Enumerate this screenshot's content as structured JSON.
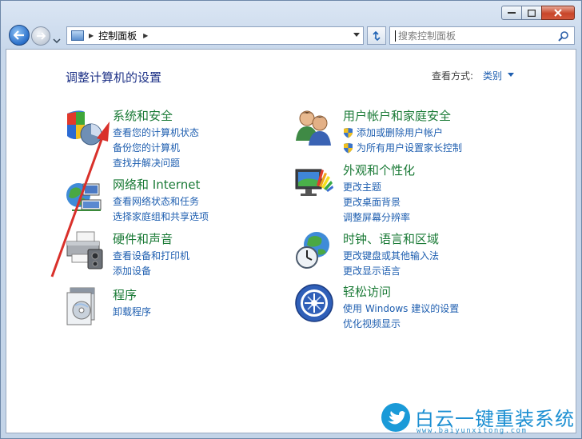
{
  "window": {
    "caption_buttons": [
      "minimize",
      "maximize",
      "close"
    ]
  },
  "navbar": {
    "breadcrumb": [
      "控制面板"
    ],
    "search_placeholder": "搜索控制面板"
  },
  "content": {
    "heading": "调整计算机的设置",
    "view_by_label": "查看方式:",
    "view_by_value": "类别"
  },
  "categories": {
    "system": {
      "title": "系统和安全",
      "icon": "shield-pie-icon",
      "links": [
        "查看您的计算机状态",
        "备份您的计算机",
        "查找并解决问题"
      ]
    },
    "network": {
      "title": "网络和 Internet",
      "icon": "globe-network-icon",
      "links": [
        "查看网络状态和任务",
        "选择家庭组和共享选项"
      ]
    },
    "hardware": {
      "title": "硬件和声音",
      "icon": "printer-icon",
      "links": [
        "查看设备和打印机",
        "添加设备"
      ]
    },
    "programs": {
      "title": "程序",
      "icon": "programs-disc-icon",
      "links": [
        "卸载程序"
      ]
    },
    "users": {
      "title": "用户帐户和家庭安全",
      "icon": "users-icon",
      "links": [
        "添加或删除用户帐户",
        "为所有用户设置家长控制"
      ]
    },
    "appearance": {
      "title": "外观和个性化",
      "icon": "monitor-palette-icon",
      "links": [
        "更改主题",
        "更改桌面背景",
        "调整屏幕分辨率"
      ]
    },
    "clock": {
      "title": "时钟、语言和区域",
      "icon": "globe-clock-icon",
      "links": [
        "更改键盘或其他输入法",
        "更改显示语言"
      ]
    },
    "ease": {
      "title": "轻松访问",
      "icon": "ease-of-access-icon",
      "links": [
        "使用 Windows 建议的设置",
        "优化视频显示"
      ]
    }
  },
  "watermark": {
    "brand": "白云一键重装系统",
    "url": "www.baiyunxitong.com"
  },
  "colors": {
    "link": "#1f5fb0",
    "category_title": "#1a7a36",
    "heading": "#1e3287",
    "annotation_arrow": "#d9302a"
  }
}
